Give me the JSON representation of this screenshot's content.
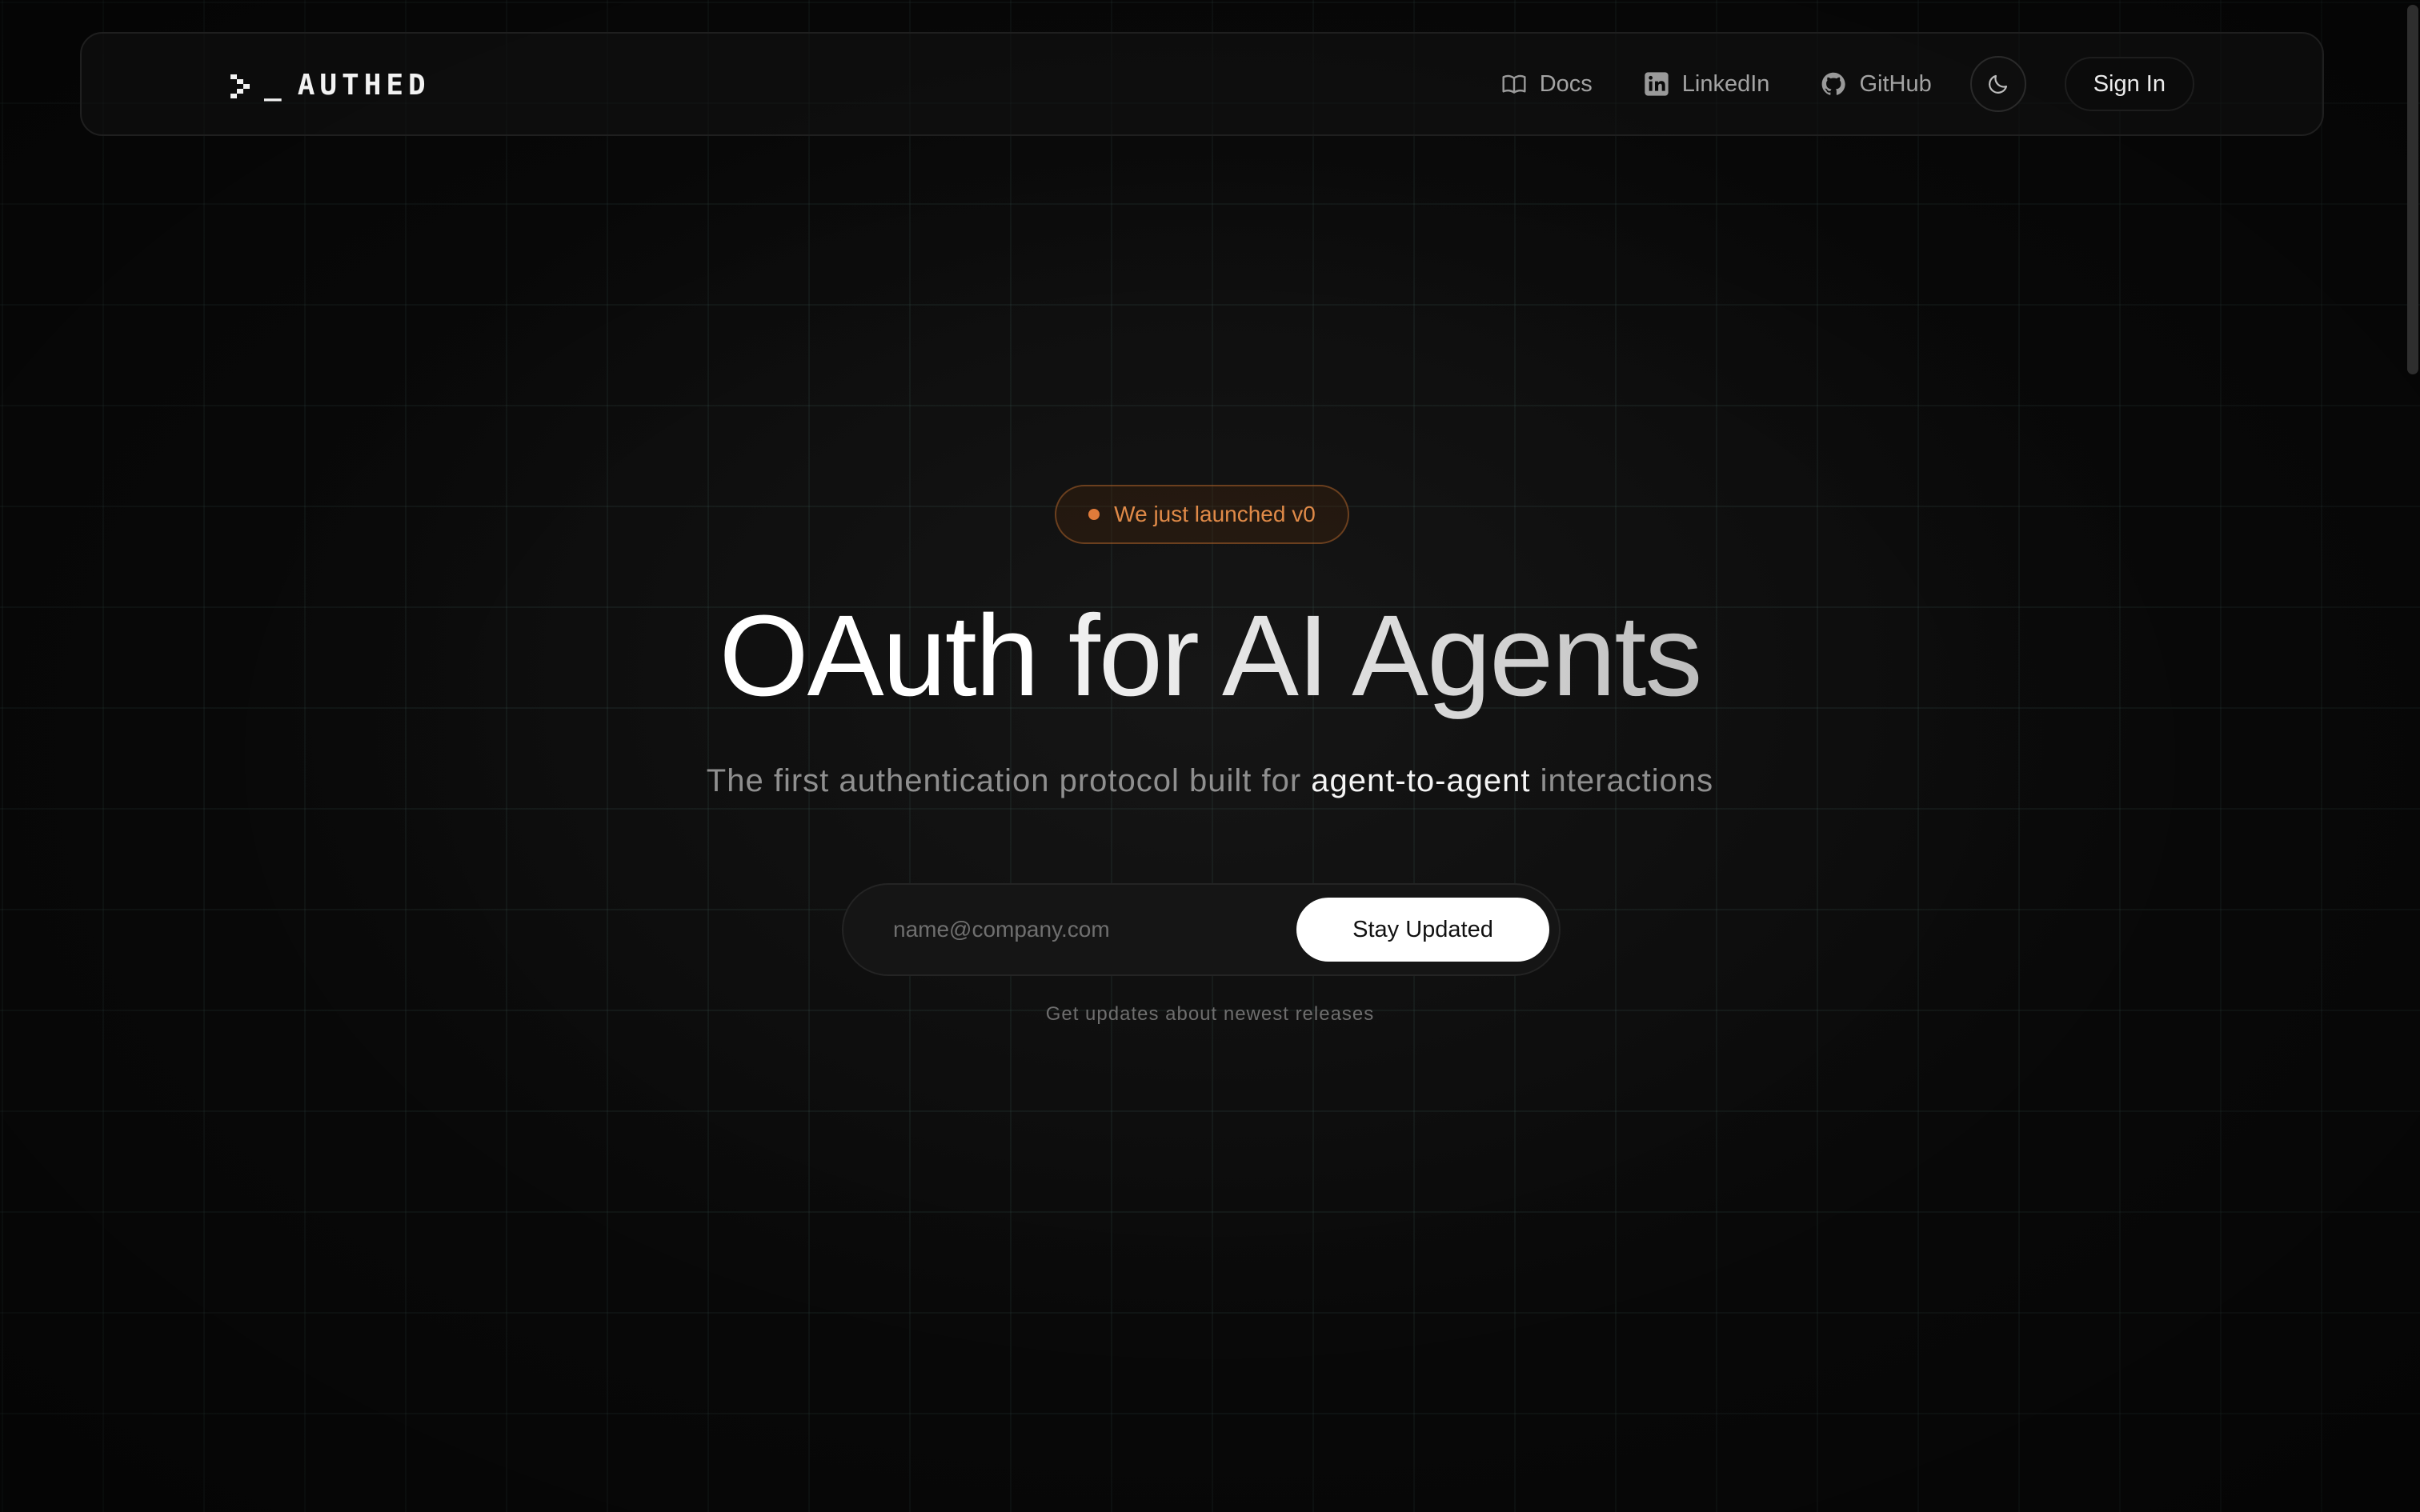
{
  "nav": {
    "logo_text": "AUTHED",
    "links": [
      {
        "label": "Docs",
        "icon": "book-icon"
      },
      {
        "label": "LinkedIn",
        "icon": "linkedin-icon"
      },
      {
        "label": "GitHub",
        "icon": "github-icon"
      }
    ],
    "theme_toggle_icon": "moon-icon",
    "signin_label": "Sign In"
  },
  "hero": {
    "badge_text": "We just launched v0",
    "badge_color": "#e08a48",
    "headline_strong": "OAuth",
    "headline_rest": "for AI Agents",
    "subtitle_before": "The first authentication protocol built for",
    "subtitle_highlight": "agent-to-agent",
    "subtitle_after": "interactions",
    "email_placeholder": "name@company.com",
    "cta_label": "Stay Updated",
    "caption": "Get updates about newest releases"
  }
}
